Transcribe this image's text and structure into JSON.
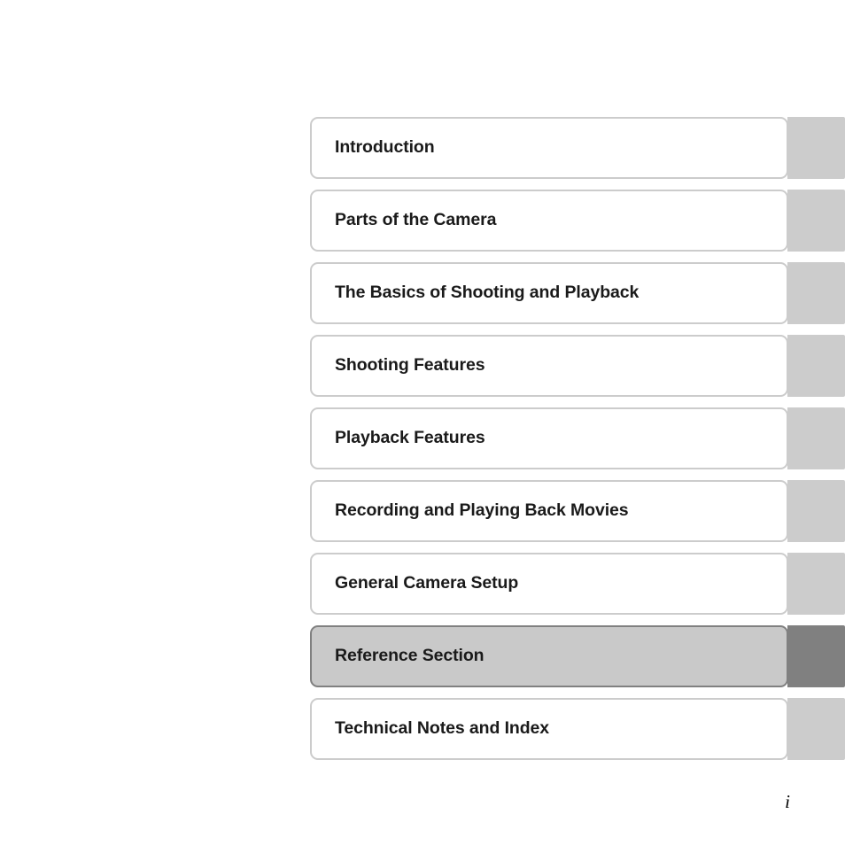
{
  "page": {
    "background_color": "#ffffff",
    "folio": "i"
  },
  "theme": {
    "tab_body_color": "#ffffff",
    "tab_border_color": "#cccccc",
    "tab_ear_color": "#cccccc",
    "active_tab_body_color": "#c9c9c9",
    "active_tab_border_color": "#808080",
    "active_tab_ear_color": "#808080",
    "label_color": "#1a1a1a"
  },
  "contents": {
    "tabs": [
      {
        "label": "Introduction",
        "active": false
      },
      {
        "label": "Parts of the Camera",
        "active": false
      },
      {
        "label": "The Basics of Shooting and Playback",
        "active": false
      },
      {
        "label": "Shooting Features",
        "active": false
      },
      {
        "label": "Playback Features",
        "active": false
      },
      {
        "label": "Recording and Playing Back Movies",
        "active": false
      },
      {
        "label": "General Camera Setup",
        "active": false
      },
      {
        "label": "Reference Section",
        "active": true
      },
      {
        "label": "Technical Notes and Index",
        "active": false
      }
    ]
  }
}
